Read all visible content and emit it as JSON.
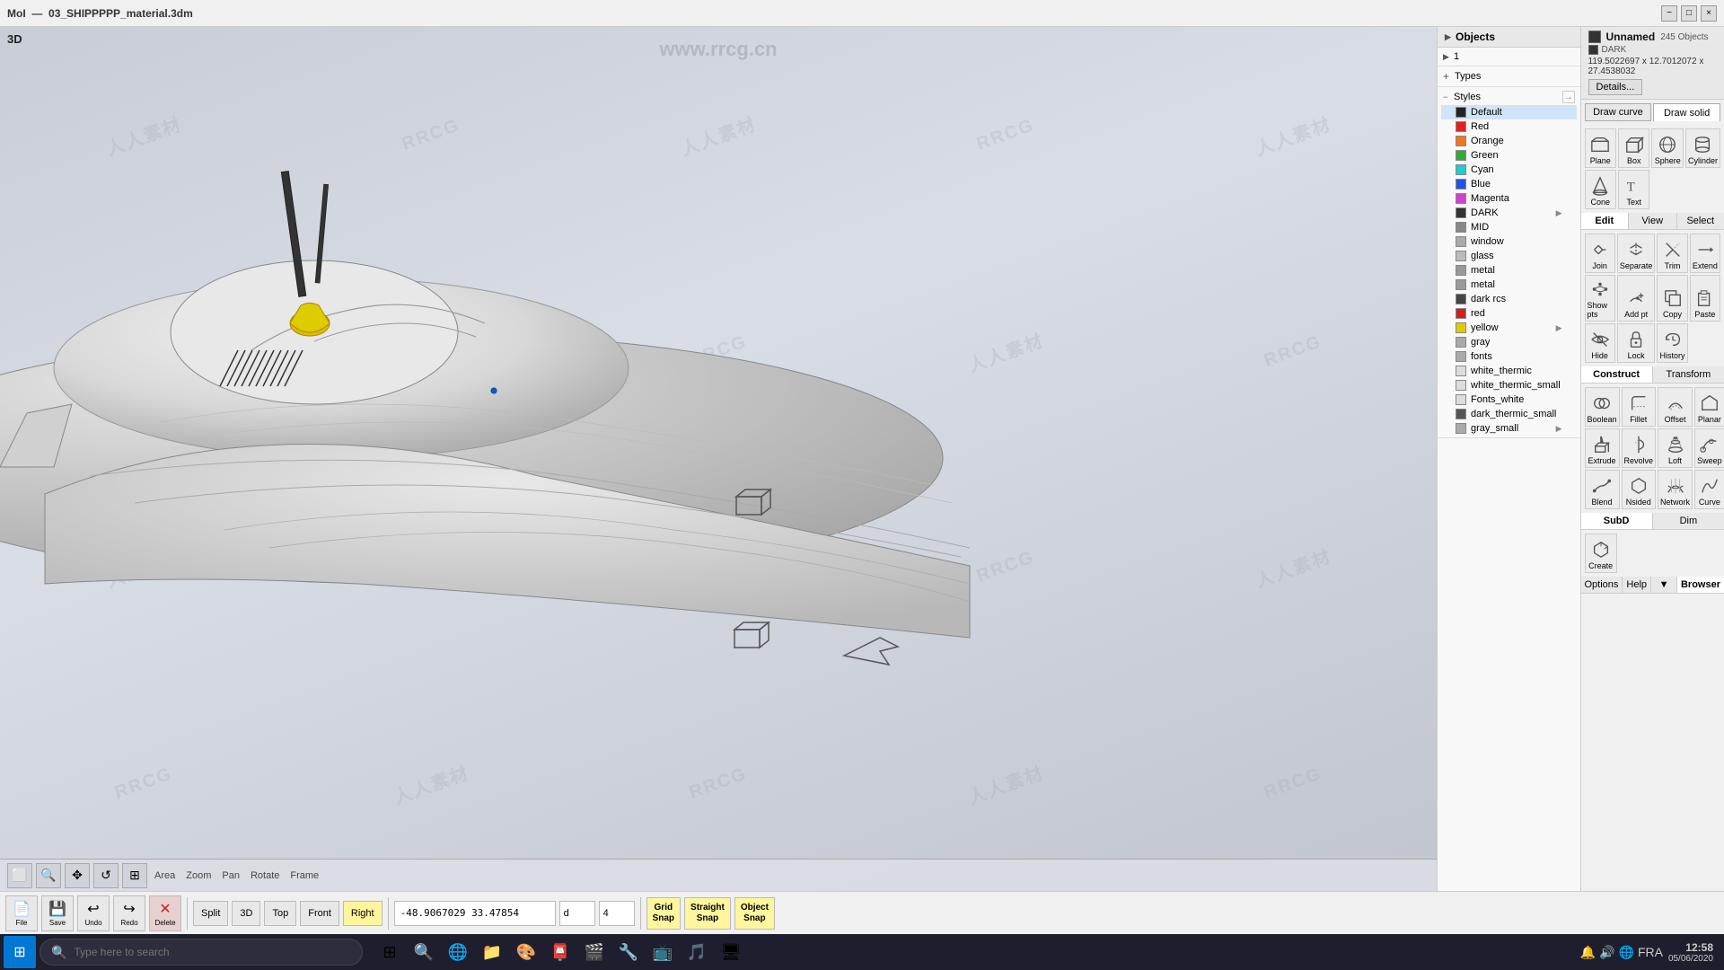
{
  "window": {
    "title": "MoI",
    "filename": "03_SHIPPPPP_material.3dm",
    "controls": [
      "−",
      "□",
      "×"
    ]
  },
  "viewport": {
    "label": "3D",
    "url_watermark": "www.rrcg.cn",
    "cursor_coords": "-48.9067029  33.47854",
    "cursor_d": "d"
  },
  "objects_panel": {
    "header": "Objects",
    "expand_label": "1",
    "types_label": "Types",
    "styles_label": "Styles",
    "styles_export_btn": "→",
    "items": [
      {
        "label": "Default",
        "color": "#222222",
        "is_swatch": true,
        "active": true
      },
      {
        "label": "Red",
        "color": "#dd2222",
        "is_swatch": true
      },
      {
        "label": "Orange",
        "color": "#ee7722",
        "is_swatch": true
      },
      {
        "label": "Green",
        "color": "#33aa33",
        "is_swatch": true
      },
      {
        "label": "Cyan",
        "color": "#22cccc",
        "is_swatch": true
      },
      {
        "label": "Blue",
        "color": "#2255dd",
        "is_swatch": true
      },
      {
        "label": "Magenta",
        "color": "#cc44cc",
        "is_swatch": true
      },
      {
        "label": "DARK",
        "color": "#333333",
        "is_swatch": true,
        "expandable": true
      },
      {
        "label": "MID",
        "color": "#888888",
        "is_swatch": false
      },
      {
        "label": "window",
        "color": "#aaaaaa",
        "is_swatch": false
      },
      {
        "label": "glass",
        "color": "#bbbbbb",
        "is_swatch": false
      },
      {
        "label": "metal",
        "color": "#999999",
        "is_swatch": false
      },
      {
        "label": "metal",
        "color": "#999999",
        "is_swatch": false
      },
      {
        "label": "dark rcs",
        "color": "#444444",
        "is_swatch": true
      },
      {
        "label": "red",
        "color": "#cc2222",
        "is_swatch": true
      },
      {
        "label": "yellow",
        "color": "#ddcc00",
        "is_swatch": true,
        "expandable": true
      },
      {
        "label": "gray",
        "color": "#aaaaaa",
        "is_swatch": false
      },
      {
        "label": "fonts",
        "color": "#aaaaaa",
        "is_swatch": false
      },
      {
        "label": "white_thermic",
        "color": "#dddddd",
        "is_swatch": false
      },
      {
        "label": "white_thermic_small",
        "color": "#dddddd",
        "is_swatch": false
      },
      {
        "label": "Fonts_white",
        "color": "#dddddd",
        "is_swatch": false
      },
      {
        "label": "dark_thermic_small",
        "color": "#555555",
        "is_swatch": true
      },
      {
        "label": "gray_small",
        "color": "#aaaaaa",
        "is_swatch": false,
        "expandable": true
      }
    ]
  },
  "tools_panel": {
    "info": {
      "name": "Unnamed",
      "count": "245 Objects",
      "swatch": "#333333",
      "swatch_label": "DARK",
      "coords": "119.5022697 x 12.7012072 x\n27.4538032",
      "details_btn": "Details..."
    },
    "draw_tabs": [
      {
        "label": "Draw curve",
        "active": false
      },
      {
        "label": "Draw solid",
        "active": true
      }
    ],
    "solid_tools": [
      {
        "icon": "plane",
        "label": "Plane"
      },
      {
        "icon": "box",
        "label": "Box"
      },
      {
        "icon": "sphere",
        "label": "Sphere"
      },
      {
        "icon": "cylinder",
        "label": "Cylinder"
      },
      {
        "icon": "cone",
        "label": "Cone"
      },
      {
        "icon": "text",
        "label": "Text"
      }
    ],
    "edit_tabs": [
      "Edit",
      "View",
      "Select"
    ],
    "edit_active": "Edit",
    "edit_tools": [
      {
        "icon": "join",
        "label": "Join"
      },
      {
        "icon": "separate",
        "label": "Separate"
      },
      {
        "icon": "trim",
        "label": "Trim"
      },
      {
        "icon": "extend",
        "label": "Extend"
      },
      {
        "icon": "show_pts",
        "label": "Show pts"
      },
      {
        "icon": "add_pt",
        "label": "Add pt"
      },
      {
        "icon": "copy",
        "label": "Copy"
      },
      {
        "icon": "paste",
        "label": "Paste"
      },
      {
        "icon": "hide",
        "label": "Hide"
      },
      {
        "icon": "lock",
        "label": "Lock"
      },
      {
        "icon": "history",
        "label": "History"
      }
    ],
    "construct_tabs": [
      "Construct",
      "Transform"
    ],
    "construct_active": "Construct",
    "construct_tools": [
      {
        "icon": "boolean",
        "label": "Boolean"
      },
      {
        "icon": "fillet",
        "label": "Fillet"
      },
      {
        "icon": "offset",
        "label": "Offset"
      },
      {
        "icon": "planar",
        "label": "Planar"
      },
      {
        "icon": "extrude",
        "label": "Extrude"
      },
      {
        "icon": "revolve",
        "label": "Revolve"
      },
      {
        "icon": "loft",
        "label": "Loft"
      },
      {
        "icon": "sweep",
        "label": "Sweep"
      },
      {
        "icon": "blend",
        "label": "Blend"
      },
      {
        "icon": "nsided",
        "label": "Nsided"
      },
      {
        "icon": "network",
        "label": "Network"
      },
      {
        "icon": "curve",
        "label": "Curve"
      }
    ],
    "subd_tabs": [
      "SubD",
      "Dim"
    ],
    "subd_tools": [
      {
        "icon": "create",
        "label": "Create"
      }
    ],
    "extra_tabs": [
      "Options",
      "Help",
      "▼",
      "Browser"
    ]
  },
  "bottom_bar": {
    "file_btn": "File",
    "save_btn": "Save",
    "undo_btn": "Undo",
    "redo_btn": "Redo",
    "delete_btn": "Delete",
    "split_btn": "Split",
    "view_3d": "3D",
    "view_top": "Top",
    "view_front": "Front",
    "view_right": "Right",
    "coords": "-48.9067029  33.47854",
    "input_d": "d",
    "input_4": "4",
    "grid_snap": "Grid\nSnap",
    "straight_snap": "Straight\nSnap",
    "object_snap": "Object\nSnap"
  },
  "taskbar": {
    "search_placeholder": "Type here to search",
    "apps": [
      "⊞",
      "🔍",
      "🌐",
      "📁",
      "🎨",
      "📧",
      "🎵",
      "📺",
      "🔧"
    ],
    "tray_time": "12:58",
    "tray_date": "05/06/2020",
    "tray_lang": "FRA"
  }
}
